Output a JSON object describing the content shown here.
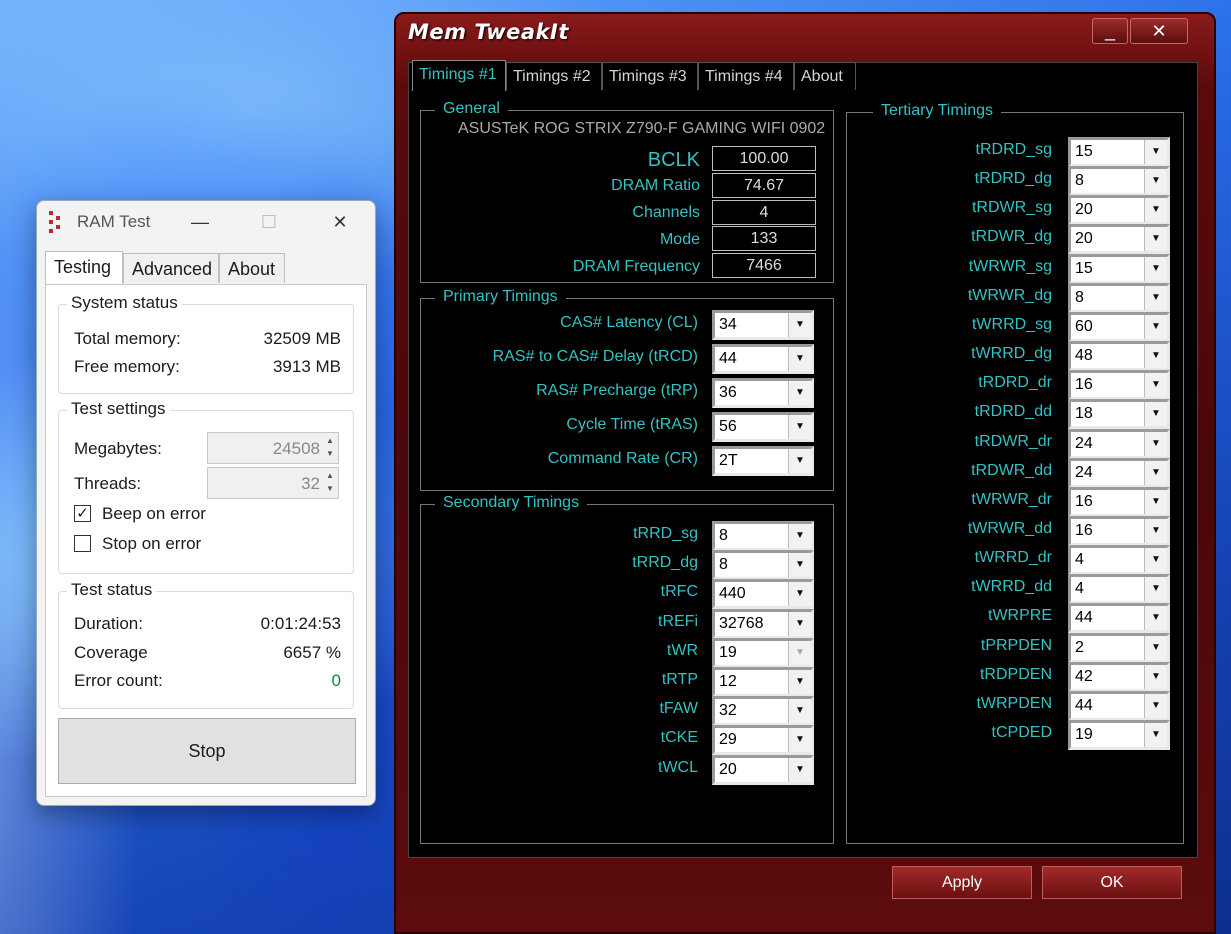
{
  "ram_test": {
    "title": "RAM Test",
    "controls": {
      "minimize": "—",
      "maximize": "☐",
      "close": "✕"
    },
    "tabs": [
      "Testing",
      "Advanced",
      "About"
    ],
    "system_status": {
      "title": "System status",
      "total_label": "Total memory:",
      "total_value": "32509 MB",
      "free_label": "Free memory:",
      "free_value": "3913 MB"
    },
    "test_settings": {
      "title": "Test settings",
      "megabytes_label": "Megabytes:",
      "megabytes_value": "24508",
      "threads_label": "Threads:",
      "threads_value": "32",
      "beep_label": "Beep on error",
      "beep_checked": true,
      "stop_label": "Stop on error",
      "stop_checked": false
    },
    "test_status": {
      "title": "Test status",
      "duration_label": "Duration:",
      "duration_value": "0:01:24:53",
      "coverage_label": "Coverage",
      "coverage_value": "6657 %",
      "error_label": "Error count:",
      "error_value": "0"
    },
    "stop_button": "Stop"
  },
  "memtweakit": {
    "title": "Mem TweakIt",
    "controls": {
      "minimize": "_",
      "close": "✕"
    },
    "tabs": [
      "Timings #1",
      "Timings #2",
      "Timings #3",
      "Timings #4",
      "About"
    ],
    "general": {
      "title": "General",
      "board": "ASUSTeK ROG STRIX Z790-F GAMING WIFI 0902",
      "bclk_label": "BCLK",
      "bclk_value": "100.00",
      "ratio_label": "DRAM Ratio",
      "ratio_value": "74.67",
      "channels_label": "Channels",
      "channels_value": "4",
      "mode_label": "Mode",
      "mode_value": "133",
      "freq_label": "DRAM Frequency",
      "freq_value": "7466"
    },
    "primary": {
      "title": "Primary Timings",
      "items": [
        {
          "label": "CAS# Latency (CL)",
          "value": "34"
        },
        {
          "label": "RAS# to CAS# Delay (tRCD)",
          "value": "44"
        },
        {
          "label": "RAS# Precharge (tRP)",
          "value": "36"
        },
        {
          "label": "Cycle Time (tRAS)",
          "value": "56"
        },
        {
          "label": "Command Rate (CR)",
          "value": "2T"
        }
      ]
    },
    "secondary": {
      "title": "Secondary Timings",
      "items": [
        {
          "label": "tRRD_sg",
          "value": "8"
        },
        {
          "label": "tRRD_dg",
          "value": "8"
        },
        {
          "label": "tRFC",
          "value": "440"
        },
        {
          "label": "tREFi",
          "value": "32768"
        },
        {
          "label": "tWR",
          "value": "19"
        },
        {
          "label": "tRTP",
          "value": "12"
        },
        {
          "label": "tFAW",
          "value": "32"
        },
        {
          "label": "tCKE",
          "value": "29"
        },
        {
          "label": "tWCL",
          "value": "20"
        }
      ]
    },
    "tertiary": {
      "title": "Tertiary Timings",
      "items": [
        {
          "label": "tRDRD_sg",
          "value": "15"
        },
        {
          "label": "tRDRD_dg",
          "value": "8"
        },
        {
          "label": "tRDWR_sg",
          "value": "20"
        },
        {
          "label": "tRDWR_dg",
          "value": "20"
        },
        {
          "label": "tWRWR_sg",
          "value": "15"
        },
        {
          "label": "tWRWR_dg",
          "value": "8"
        },
        {
          "label": "tWRRD_sg",
          "value": "60"
        },
        {
          "label": "tWRRD_dg",
          "value": "48"
        },
        {
          "label": "tRDRD_dr",
          "value": "16"
        },
        {
          "label": "tRDRD_dd",
          "value": "18"
        },
        {
          "label": "tRDWR_dr",
          "value": "24"
        },
        {
          "label": "tRDWR_dd",
          "value": "24"
        },
        {
          "label": "tWRWR_dr",
          "value": "16"
        },
        {
          "label": "tWRWR_dd",
          "value": "16"
        },
        {
          "label": "tWRRD_dr",
          "value": "4"
        },
        {
          "label": "tWRRD_dd",
          "value": "4"
        },
        {
          "label": "tWRPRE",
          "value": "44"
        },
        {
          "label": "tPRPDEN",
          "value": "2"
        },
        {
          "label": "tRDPDEN",
          "value": "42"
        },
        {
          "label": "tWRPDEN",
          "value": "44"
        },
        {
          "label": "tCPDED",
          "value": "19"
        }
      ]
    },
    "apply_button": "Apply",
    "ok_button": "OK"
  }
}
